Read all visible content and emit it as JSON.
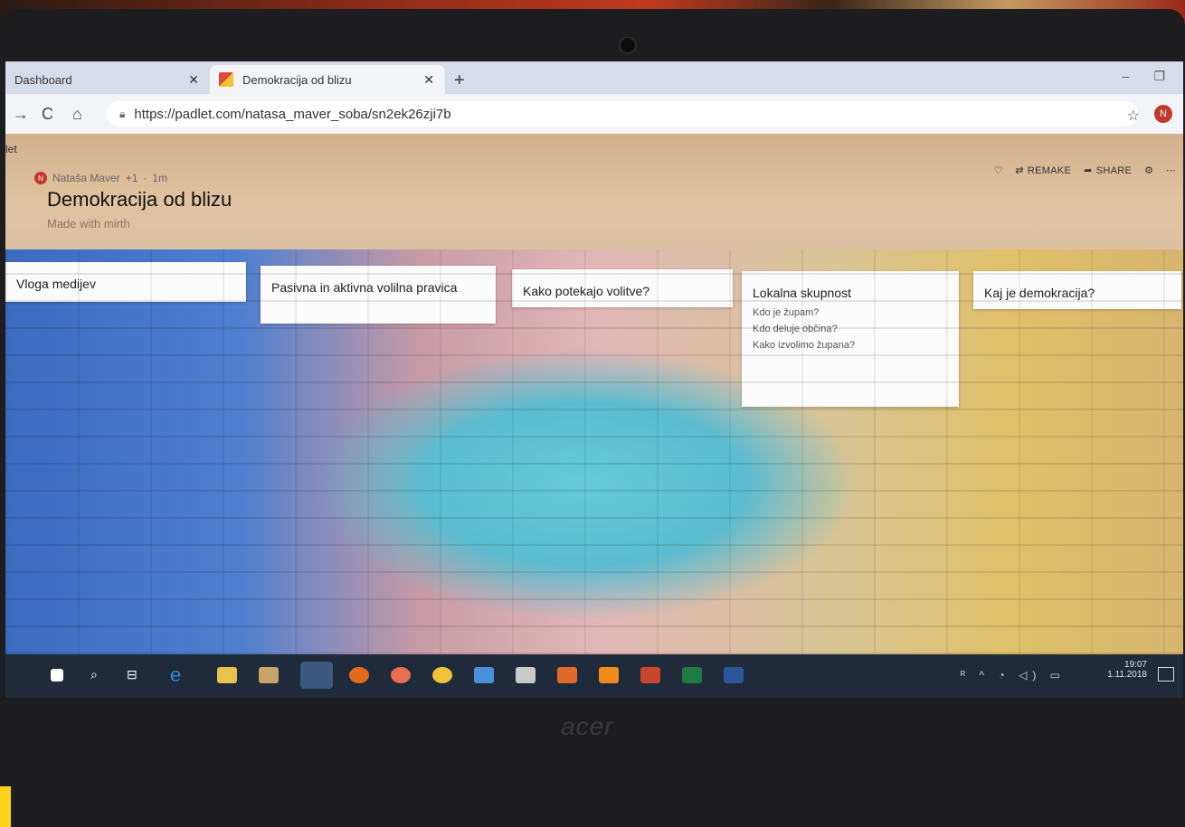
{
  "browser": {
    "tabs": [
      {
        "label": "Dashboard"
      },
      {
        "label": "Demokracija od blizu"
      }
    ],
    "url": "https://padlet.com/natasa_maver_soba/sn2ek26zji7b",
    "profile_initial": "N"
  },
  "padlet": {
    "app_label": "let",
    "author": "Nataša Maver",
    "likes": "+1",
    "age": "1m",
    "title": "Demokracija od blizu",
    "subtitle": "Made with mirth",
    "actions": {
      "remake": "REMAKE",
      "share": "SHARE"
    }
  },
  "columns": [
    {
      "title": "Vloga medijev",
      "items": []
    },
    {
      "title": "Pasivna in aktivna volilna pravica",
      "items": []
    },
    {
      "title": "Kako potekajo volitve?",
      "items": []
    },
    {
      "title": "Lokalna skupnost",
      "items": [
        "Kdo je župam?",
        "Kdo deluje občina?",
        "Kako izvolimo župana?"
      ]
    },
    {
      "title": "Kaj je demokracija?",
      "items": []
    }
  ],
  "taskbar": {
    "time": "19:07",
    "date": "1.11.2018"
  },
  "laptop": {
    "brand": "acer"
  },
  "colors": {
    "fab": "#e2478d",
    "taskbar": "#1f2a3a",
    "avatar": "#c0392b"
  }
}
